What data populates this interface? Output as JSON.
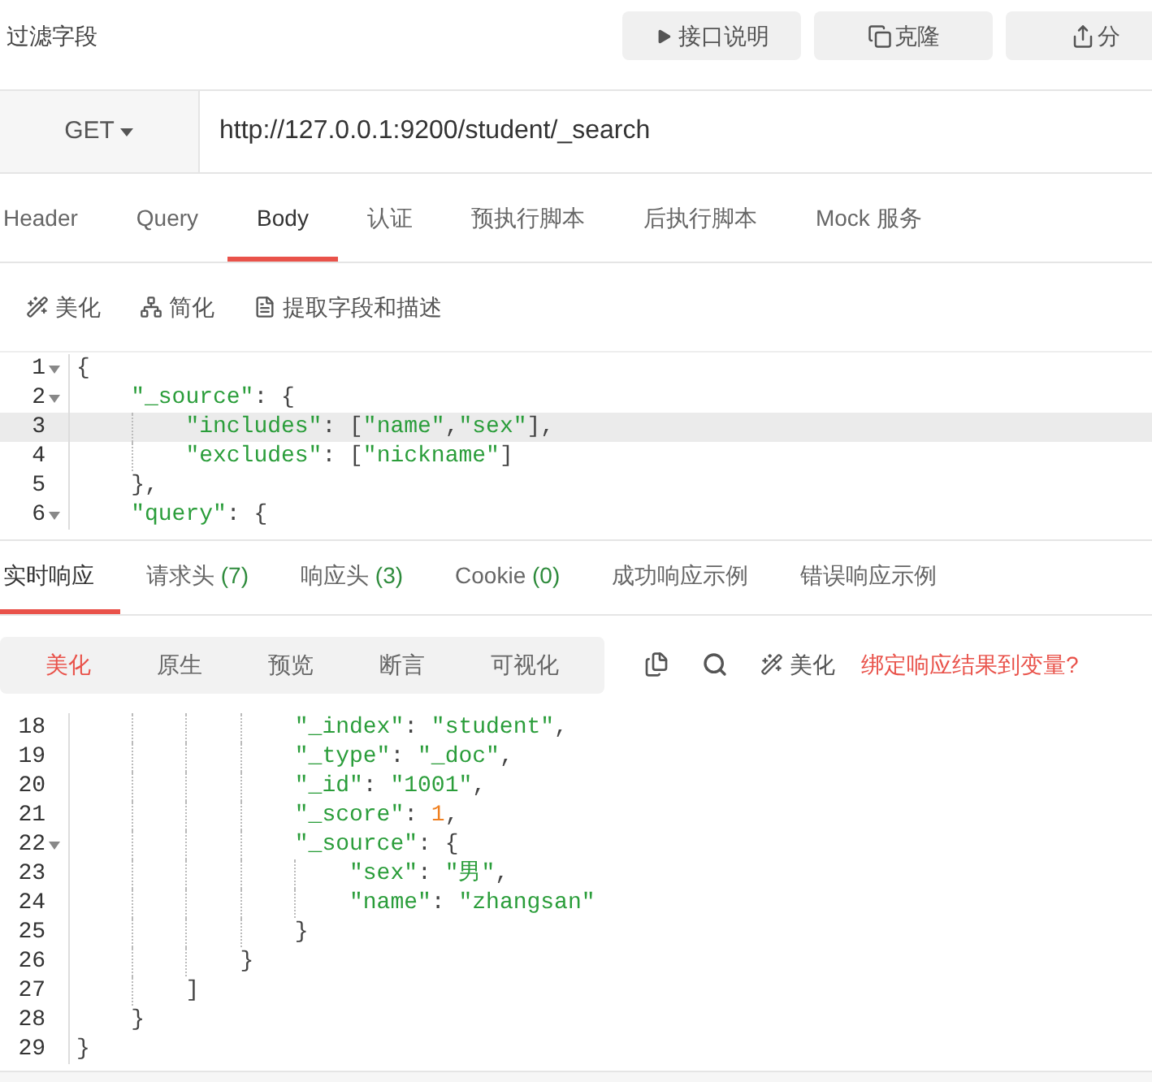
{
  "header": {
    "title": "过滤字段",
    "buttons": [
      {
        "kind": "play",
        "label": "接口说明"
      },
      {
        "kind": "clone",
        "label": "克隆"
      },
      {
        "kind": "share",
        "label": "分"
      }
    ]
  },
  "request": {
    "method": "GET",
    "url": "http://127.0.0.1:9200/student/_search"
  },
  "request_tabs": [
    {
      "label": "Header",
      "selected": false
    },
    {
      "label": "Query",
      "selected": false
    },
    {
      "label": "Body",
      "selected": true
    },
    {
      "label": "认证",
      "selected": false
    },
    {
      "label": "预执行脚本",
      "selected": false
    },
    {
      "label": "后执行脚本",
      "selected": false
    },
    {
      "label": "Mock 服务",
      "selected": false
    }
  ],
  "body_toolbar": [
    {
      "kind": "wand",
      "label": "美化"
    },
    {
      "kind": "tree",
      "label": "简化"
    },
    {
      "kind": "doc",
      "label": "提取字段和描述"
    }
  ],
  "body_editor": {
    "lines": [
      {
        "number": "1",
        "foldable": true,
        "active": false,
        "tokens": [
          {
            "kind": "punct",
            "text": "{"
          }
        ],
        "children": [
          {
            "number": "2",
            "foldable": true,
            "active": false,
            "tokens": [
              {
                "kind": "string",
                "text": "\"_source\""
              },
              {
                "kind": "punct",
                "text": ": {"
              }
            ],
            "children": [
              {
                "number": "3",
                "foldable": false,
                "active": true,
                "tokens": [
                  {
                    "kind": "string",
                    "text": "\"includes\""
                  },
                  {
                    "kind": "punct",
                    "text": ": ["
                  },
                  {
                    "kind": "string",
                    "text": "\"name\""
                  },
                  {
                    "kind": "punct",
                    "text": ","
                  },
                  {
                    "kind": "string",
                    "text": "\"sex\""
                  },
                  {
                    "kind": "punct",
                    "text": "],"
                  }
                ]
              },
              {
                "number": "4",
                "foldable": false,
                "active": false,
                "tokens": [
                  {
                    "kind": "string",
                    "text": "\"excludes\""
                  },
                  {
                    "kind": "punct",
                    "text": ": ["
                  },
                  {
                    "kind": "string",
                    "text": "\"nickname\""
                  },
                  {
                    "kind": "punct",
                    "text": "]"
                  }
                ]
              }
            ]
          },
          {
            "number": "5",
            "foldable": false,
            "active": false,
            "tokens": [
              {
                "kind": "punct",
                "text": "},"
              }
            ]
          },
          {
            "number": "6",
            "foldable": true,
            "active": false,
            "tokens": [
              {
                "kind": "string",
                "text": "\"query\""
              },
              {
                "kind": "punct",
                "text": ": {"
              }
            ]
          }
        ]
      }
    ]
  },
  "response_tabs": [
    {
      "label": "实时响应",
      "selected": true
    },
    {
      "label": "请求头",
      "count": "(7)",
      "selected": false
    },
    {
      "label": "响应头",
      "count": "(3)",
      "selected": false
    },
    {
      "label": "Cookie",
      "count": "(0)",
      "selected": false
    },
    {
      "label": "成功响应示例",
      "selected": false
    },
    {
      "label": "错误响应示例",
      "selected": false
    }
  ],
  "view_modes": [
    {
      "label": "美化",
      "selected": true
    },
    {
      "label": "原生",
      "selected": false
    },
    {
      "label": "预览",
      "selected": false
    },
    {
      "label": "断言",
      "selected": false
    },
    {
      "label": "可视化",
      "selected": false
    }
  ],
  "response_actions": [
    {
      "kind": "copy"
    },
    {
      "kind": "search"
    },
    {
      "kind": "wand",
      "label": "美化"
    }
  ],
  "bind_link": "绑定响应结果到变量?",
  "response_editor": {
    "lines": [
      {
        "children": [
          {
            "children": [
              {
                "children": [
                  {
                    "children": [
                      {
                        "number": "18",
                        "foldable": false,
                        "active": false,
                        "tokens": [
                          {
                            "kind": "string",
                            "text": "\"_index\""
                          },
                          {
                            "kind": "punct",
                            "text": ": "
                          },
                          {
                            "kind": "string",
                            "text": "\"student\""
                          },
                          {
                            "kind": "punct",
                            "text": ","
                          }
                        ]
                      },
                      {
                        "number": "19",
                        "foldable": false,
                        "active": false,
                        "tokens": [
                          {
                            "kind": "string",
                            "text": "\"_type\""
                          },
                          {
                            "kind": "punct",
                            "text": ": "
                          },
                          {
                            "kind": "string",
                            "text": "\"_doc\""
                          },
                          {
                            "kind": "punct",
                            "text": ","
                          }
                        ]
                      },
                      {
                        "number": "20",
                        "foldable": false,
                        "active": false,
                        "tokens": [
                          {
                            "kind": "string",
                            "text": "\"_id\""
                          },
                          {
                            "kind": "punct",
                            "text": ": "
                          },
                          {
                            "kind": "string",
                            "text": "\"1001\""
                          },
                          {
                            "kind": "punct",
                            "text": ","
                          }
                        ]
                      },
                      {
                        "number": "21",
                        "foldable": false,
                        "active": false,
                        "tokens": [
                          {
                            "kind": "string",
                            "text": "\"_score\""
                          },
                          {
                            "kind": "punct",
                            "text": ": "
                          },
                          {
                            "kind": "number",
                            "text": "1"
                          },
                          {
                            "kind": "punct",
                            "text": ","
                          }
                        ]
                      },
                      {
                        "number": "22",
                        "foldable": true,
                        "active": false,
                        "tokens": [
                          {
                            "kind": "string",
                            "text": "\"_source\""
                          },
                          {
                            "kind": "punct",
                            "text": ": {"
                          }
                        ],
                        "children": [
                          {
                            "number": "23",
                            "foldable": false,
                            "active": false,
                            "tokens": [
                              {
                                "kind": "string",
                                "text": "\"sex\""
                              },
                              {
                                "kind": "punct",
                                "text": ": "
                              },
                              {
                                "kind": "string",
                                "text": "\"男\""
                              },
                              {
                                "kind": "punct",
                                "text": ","
                              }
                            ]
                          },
                          {
                            "number": "24",
                            "foldable": false,
                            "active": false,
                            "tokens": [
                              {
                                "kind": "string",
                                "text": "\"name\""
                              },
                              {
                                "kind": "punct",
                                "text": ": "
                              },
                              {
                                "kind": "string",
                                "text": "\"zhangsan\""
                              }
                            ]
                          }
                        ]
                      },
                      {
                        "number": "25",
                        "foldable": false,
                        "active": false,
                        "tokens": [
                          {
                            "kind": "punct",
                            "text": "}"
                          }
                        ]
                      }
                    ]
                  },
                  {
                    "number": "26",
                    "foldable": false,
                    "active": false,
                    "tokens": [
                      {
                        "kind": "punct",
                        "text": "}"
                      }
                    ]
                  }
                ]
              },
              {
                "number": "27",
                "foldable": false,
                "active": false,
                "tokens": [
                  {
                    "kind": "punct",
                    "text": "]"
                  }
                ]
              }
            ]
          },
          {
            "number": "28",
            "foldable": false,
            "active": false,
            "tokens": [
              {
                "kind": "punct",
                "text": "}"
              }
            ]
          }
        ]
      },
      {
        "number": "29",
        "foldable": false,
        "active": false,
        "tokens": [
          {
            "kind": "punct",
            "text": "}"
          }
        ]
      }
    ]
  }
}
